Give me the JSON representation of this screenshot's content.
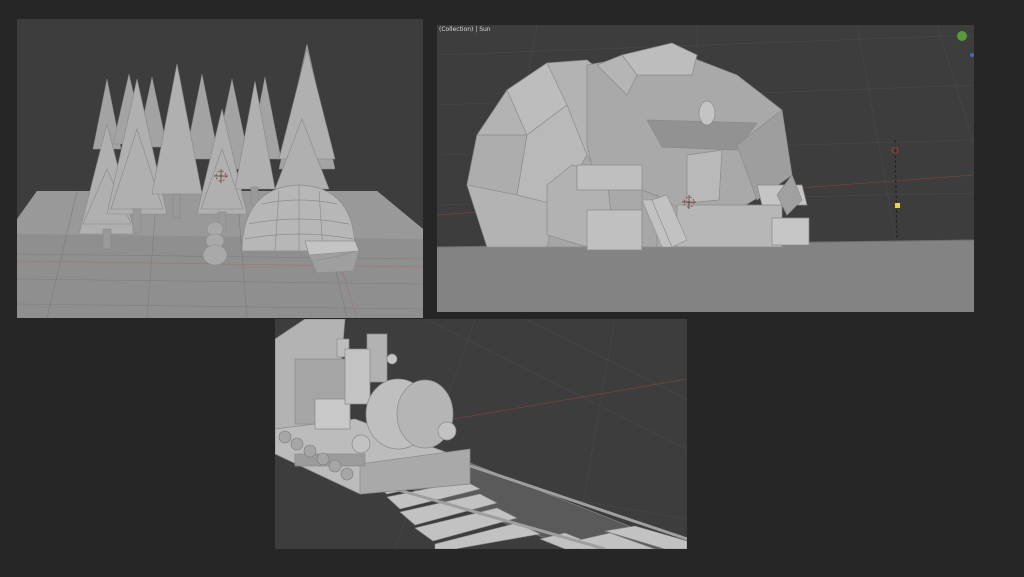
{
  "viewports": {
    "forest": {
      "name": "forest-scene"
    },
    "cave": {
      "name": "cave-scene",
      "header_text": "(Collection) | Sun"
    },
    "train": {
      "name": "train-scene"
    }
  },
  "colors": {
    "background": "#262626",
    "viewport_bg": "#3d3d3d",
    "model_gray": "#a8a8a8",
    "gizmo_green": "#5a9a3a",
    "light_yellow": "#e8d24a",
    "origin_red": "#c23b2a"
  },
  "icons": [
    "navigation-gizmo-icon",
    "3d-cursor-icon",
    "light-icon"
  ]
}
